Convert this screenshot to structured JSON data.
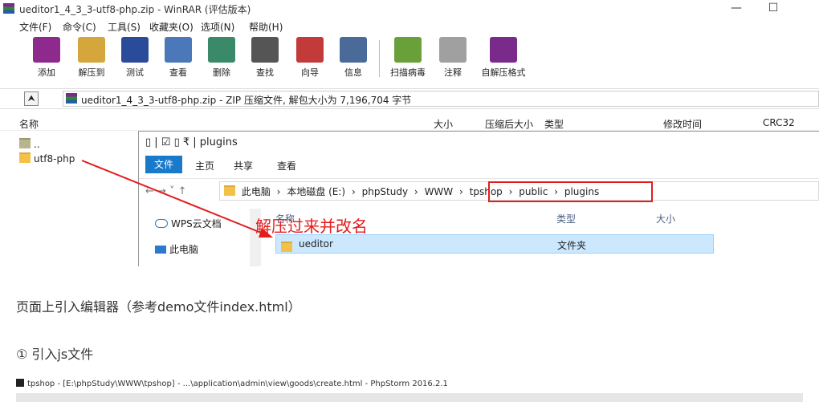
{
  "window": {
    "title": "ueditor1_4_3_3-utf8-php.zip - WinRAR (评估版本)",
    "minimize": "—",
    "maximize": "☐"
  },
  "menu": [
    "文件(F)",
    "命令(C)",
    "工具(S)",
    "收藏夹(O)",
    "选项(N)",
    "帮助(H)"
  ],
  "toolbar": [
    {
      "label": "添加",
      "icon": "add-archive-icon",
      "color": "#8e2a8e"
    },
    {
      "label": "解压到",
      "icon": "extract-to-icon",
      "color": "#d5a63c"
    },
    {
      "label": "测试",
      "icon": "test-icon",
      "color": "#2a4a9a"
    },
    {
      "label": "查看",
      "icon": "view-icon",
      "color": "#4a78b8"
    },
    {
      "label": "删除",
      "icon": "delete-icon",
      "color": "#3a8a6a"
    },
    {
      "label": "查找",
      "icon": "find-icon",
      "color": "#555555"
    },
    {
      "label": "向导",
      "icon": "wizard-icon",
      "color": "#c23a3a"
    },
    {
      "label": "信息",
      "icon": "info-icon",
      "color": "#4a6a9a"
    },
    {
      "label": "扫描病毒",
      "icon": "virus-scan-icon",
      "color": "#6aa03a"
    },
    {
      "label": "注释",
      "icon": "comment-icon",
      "color": "#a0a0a0"
    },
    {
      "label": "自解压格式",
      "icon": "sfx-icon",
      "color": "#7a2a8a"
    }
  ],
  "address": {
    "up": "⮝",
    "path": "ueditor1_4_3_3-utf8-php.zip - ZIP 压缩文件, 解包大小为 7,196,704 字节"
  },
  "columns": {
    "name": "名称",
    "size": "大小",
    "packed": "压缩后大小",
    "type": "类型",
    "modified": "修改时间",
    "crc": "CRC32"
  },
  "files": [
    {
      "name": ".."
    },
    {
      "name": "utf8-php"
    }
  ],
  "explorer": {
    "quick_access": "▯ | ☑ ▯ ₹ | plugins",
    "ribbon": {
      "file": "文件",
      "home": "主页",
      "share": "共享",
      "view": "查看"
    },
    "nav_arrows": "←  →  ˅  ↑",
    "crumbs": [
      "此电脑",
      "›",
      "本地磁盘 (E:)",
      "›",
      "phpStudy",
      "›",
      "WWW",
      "›",
      "tpshop",
      "›",
      "public",
      "›",
      "plugins"
    ],
    "nav": [
      {
        "label": "WPS云文档"
      },
      {
        "label": "此电脑"
      }
    ],
    "list_cols": {
      "name": "名称",
      "type": "类型",
      "size": "大小"
    },
    "rows": [
      {
        "name": "ueditor",
        "type": "文件夹"
      }
    ]
  },
  "annotation": "解压过来并改名",
  "article": {
    "p1": "页面上引入编辑器（参考demo文件index.html）",
    "p2": "① 引入js文件"
  },
  "phpstorm": {
    "title": "tpshop - [E:\\phpStudy\\WWW\\tpshop] - ...\\application\\admin\\view\\goods\\create.html - PhpStorm 2016.2.1"
  },
  "colors": {
    "accent": "#1979ca",
    "highlight": "#e41c1c",
    "selection": "#cce8ff"
  }
}
